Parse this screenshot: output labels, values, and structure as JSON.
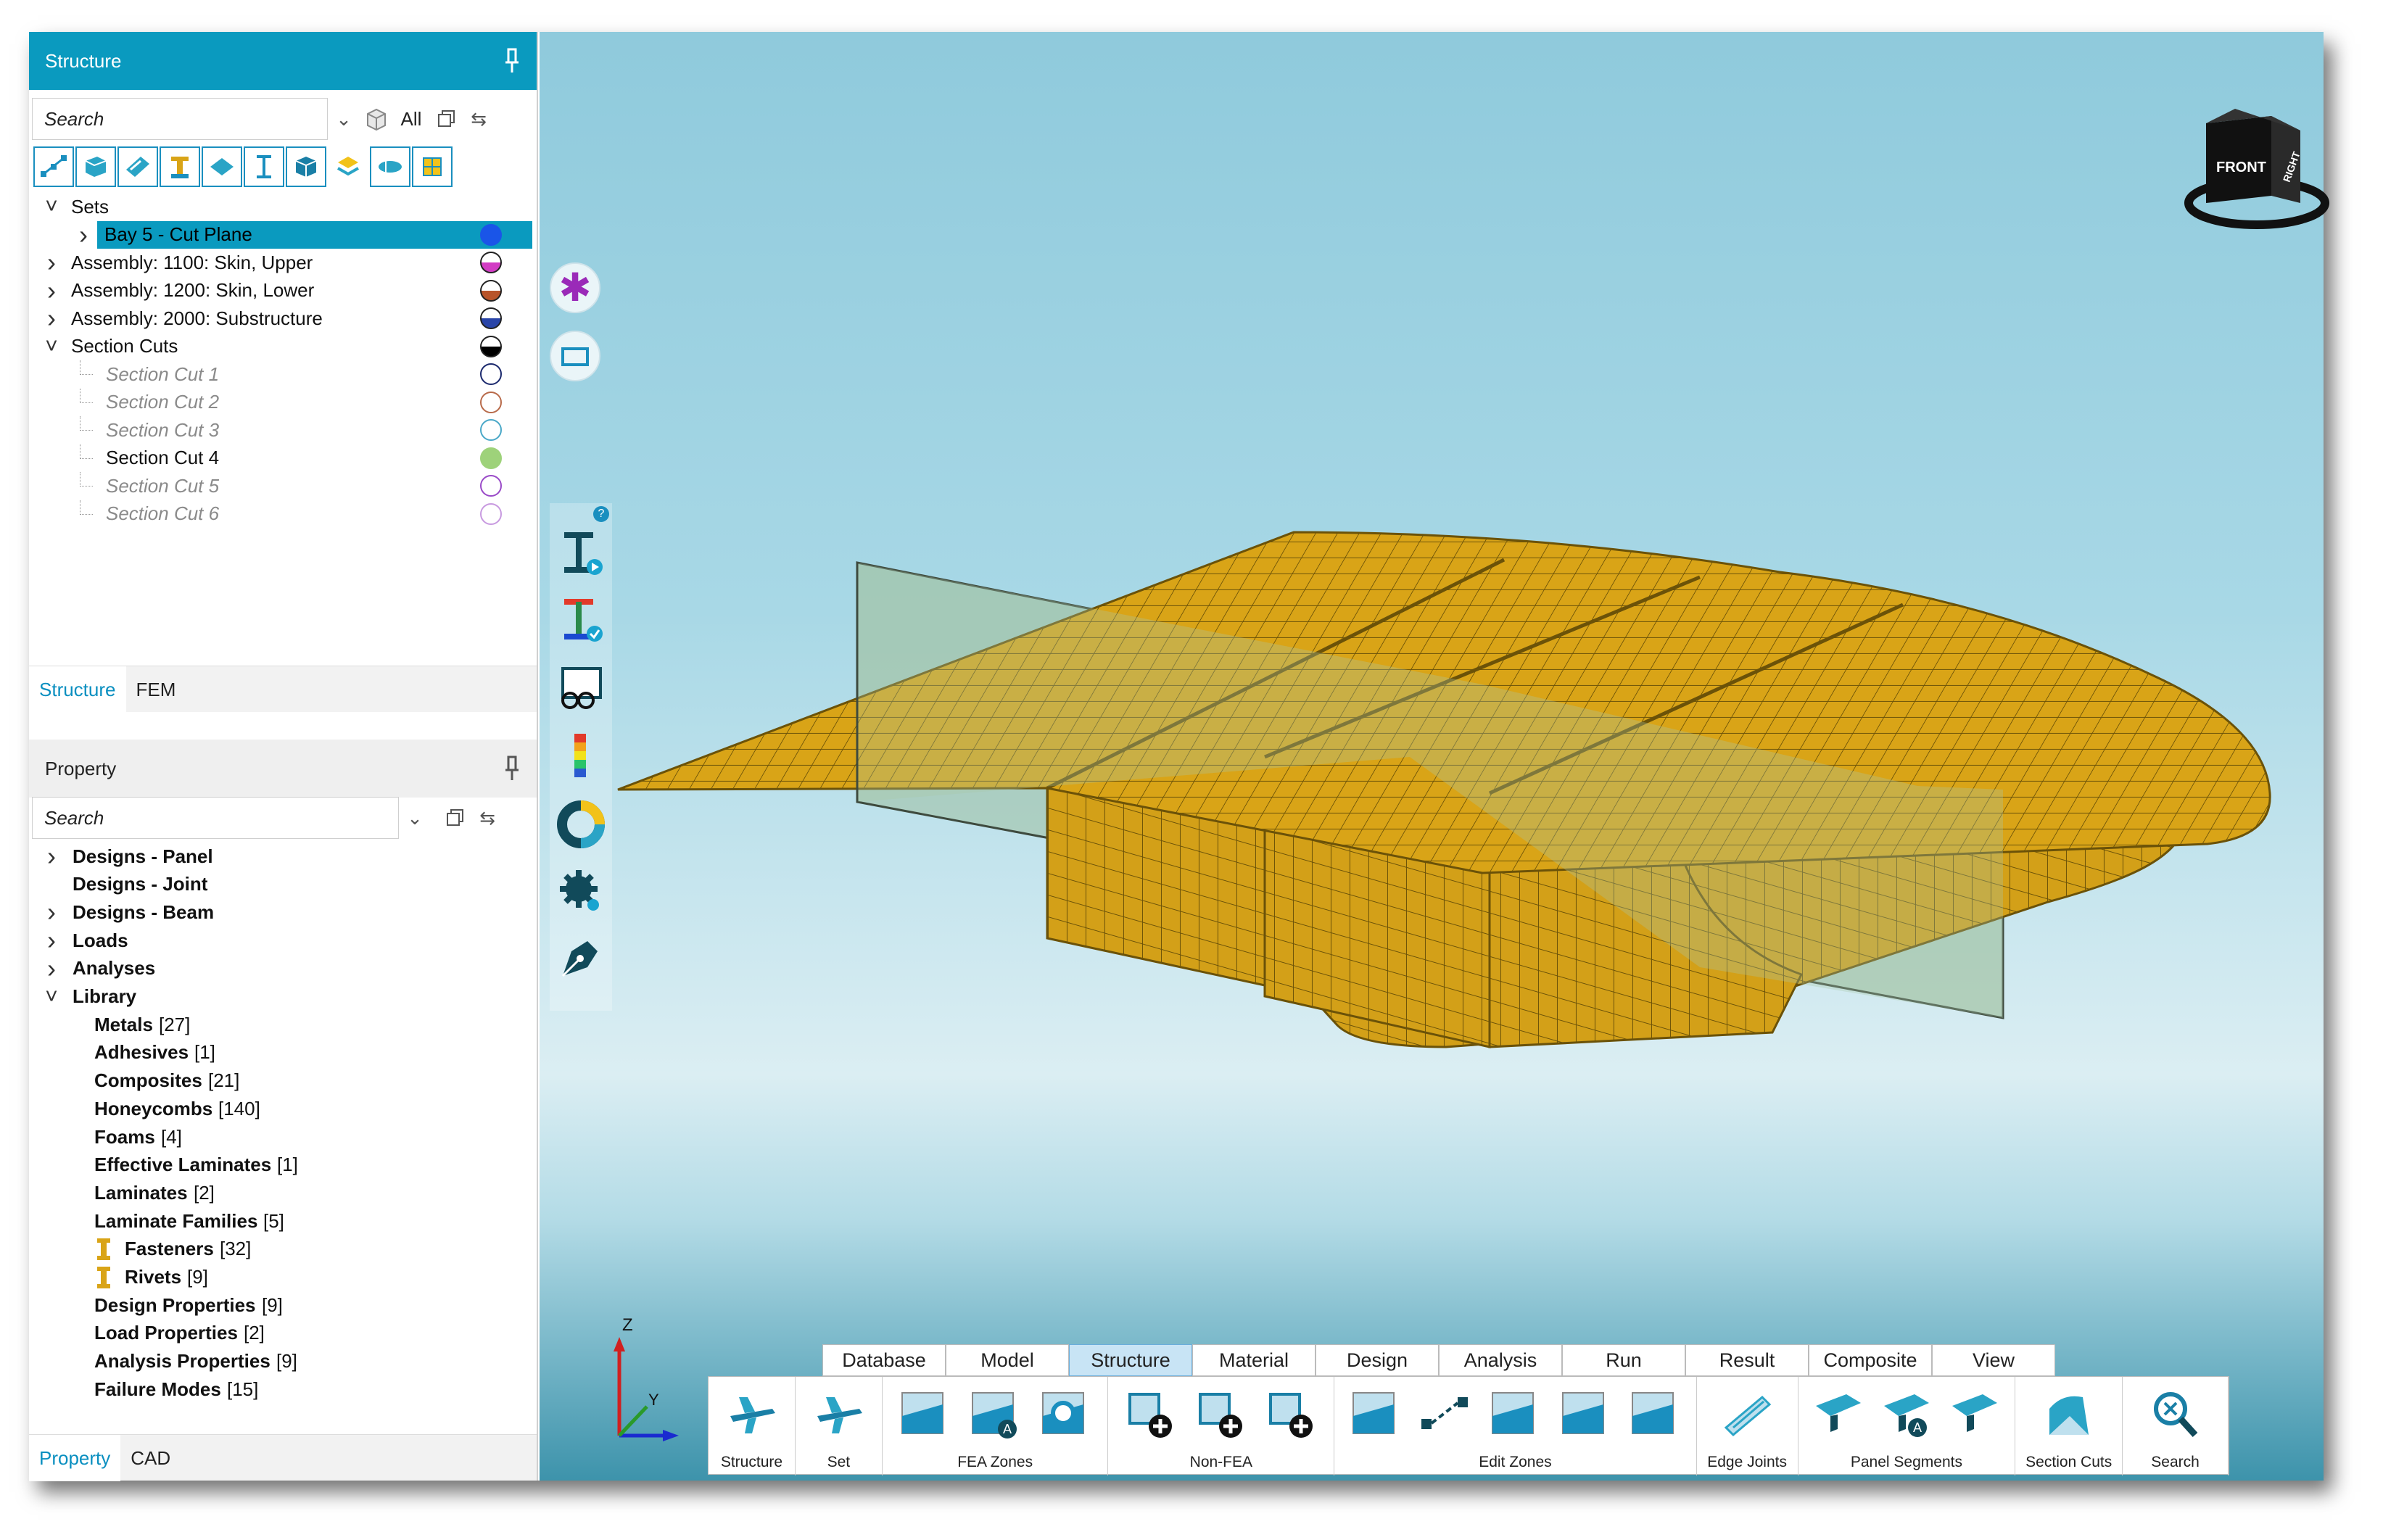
{
  "structure_panel": {
    "title": "Structure",
    "search_placeholder": "Search",
    "filter_label": "All",
    "tree": [
      {
        "label": "Sets",
        "level": 0,
        "expanded": true
      },
      {
        "label": "Bay 5 - Cut Plane",
        "level": 1,
        "selected": true,
        "dot": "#1a55e8",
        "dot_style": "filled"
      },
      {
        "label": "Assembly: 1100: Skin, Upper",
        "level": 0,
        "dot": "#d23cc4",
        "dot_style": "half"
      },
      {
        "label": "Assembly: 1200: Skin, Lower",
        "level": 0,
        "dot": "#b8542a",
        "dot_style": "half"
      },
      {
        "label": "Assembly: 2000: Substructure",
        "level": 0,
        "dot": "#2a45a8",
        "dot_style": "half"
      },
      {
        "label": "Section Cuts",
        "level": 0,
        "expanded": true,
        "dot": "#000000",
        "dot_style": "half"
      },
      {
        "label": "Section Cut 1",
        "level": 2,
        "dim": true,
        "dot": "#1c2a6e",
        "dot_style": "ring"
      },
      {
        "label": "Section Cut 2",
        "level": 2,
        "dim": true,
        "dot": "#b86a4a",
        "dot_style": "ring"
      },
      {
        "label": "Section Cut 3",
        "level": 2,
        "dim": true,
        "dot": "#4aa8c8",
        "dot_style": "ring"
      },
      {
        "label": "Section Cut 4",
        "level": 2,
        "dim": false,
        "dot": "#9ed27a",
        "dot_style": "filled"
      },
      {
        "label": "Section Cut 5",
        "level": 2,
        "dim": true,
        "dot": "#9a4ac8",
        "dot_style": "ring"
      },
      {
        "label": "Section Cut 6",
        "level": 2,
        "dim": true,
        "dot": "#c89ae0",
        "dot_style": "ring"
      }
    ],
    "tabs": [
      "Structure",
      "FEM"
    ]
  },
  "property_panel": {
    "title": "Property",
    "search_placeholder": "Search",
    "tree": [
      {
        "label": "Designs - Panel",
        "level": 0,
        "caret": true
      },
      {
        "label": "Designs - Joint",
        "level": 0,
        "caret": false
      },
      {
        "label": "Designs - Beam",
        "level": 0,
        "caret": true
      },
      {
        "label": "Loads",
        "level": 0,
        "caret": true
      },
      {
        "label": "Analyses",
        "level": 0,
        "caret": true
      },
      {
        "label": "Library",
        "level": 0,
        "caret": true,
        "expanded": true
      },
      {
        "label": "Metals",
        "count": "[27]",
        "level": 1
      },
      {
        "label": "Adhesives",
        "count": "[1]",
        "level": 1
      },
      {
        "label": "Composites",
        "count": "[21]",
        "level": 1
      },
      {
        "label": "Honeycombs",
        "count": "[140]",
        "level": 1
      },
      {
        "label": "Foams",
        "count": "[4]",
        "level": 1
      },
      {
        "label": "Effective Laminates",
        "count": "[1]",
        "level": 1
      },
      {
        "label": "Laminates",
        "count": "[2]",
        "level": 1
      },
      {
        "label": "Laminate Families",
        "count": "[5]",
        "level": 1
      },
      {
        "label": "Fasteners",
        "count": "[32]",
        "level": 1,
        "icon": true
      },
      {
        "label": "Rivets",
        "count": "[9]",
        "level": 1,
        "icon": true
      },
      {
        "label": "Design Properties",
        "count": "[9]",
        "level": 1
      },
      {
        "label": "Load Properties",
        "count": "[2]",
        "level": 1
      },
      {
        "label": "Analysis Properties",
        "count": "[9]",
        "level": 1
      },
      {
        "label": "Failure Modes",
        "count": "[15]",
        "level": 1
      }
    ],
    "tabs": [
      "Property",
      "CAD"
    ]
  },
  "viewcube": {
    "front": "FRONT",
    "right": "RIGHT"
  },
  "axes": {
    "z": "Z",
    "y": "Y"
  },
  "ribbon": {
    "tabs": [
      "Database",
      "Model",
      "Structure",
      "Material",
      "Design",
      "Analysis",
      "Run",
      "Result",
      "Composite",
      "View"
    ],
    "active_tab": "Structure",
    "groups": [
      {
        "label": "Structure",
        "icons": [
          "aircraft-structure-icon"
        ]
      },
      {
        "label": "Set",
        "icons": [
          "aircraft-set-icon"
        ]
      },
      {
        "label": "FEA Zones",
        "icons": [
          "fea-zone-icon",
          "fea-zone-auto-icon",
          "fea-zone-gear-icon"
        ]
      },
      {
        "label": "Non-FEA",
        "icons": [
          "add-zone-icon",
          "add-joint-icon",
          "add-beam-icon"
        ]
      },
      {
        "label": "Edit Zones",
        "icons": [
          "select-zone-icon",
          "split-zone-icon",
          "rotate-zone-icon",
          "grid-zone-icon",
          "merge-zone-icon"
        ]
      },
      {
        "label": "Edge Joints",
        "icons": [
          "edge-joint-icon"
        ]
      },
      {
        "label": "Panel Segments",
        "icons": [
          "panel-segment-icon",
          "panel-segment-auto-icon",
          "panel-segment-split-icon"
        ]
      },
      {
        "label": "Section Cuts",
        "icons": [
          "section-cut-icon"
        ]
      },
      {
        "label": "Search",
        "icons": [
          "search-icon"
        ]
      }
    ]
  },
  "colors": {
    "accent": "#0a9abf",
    "mesh": "#d9a417",
    "meshline": "#6b5208",
    "plane": "#9cbfa0"
  }
}
